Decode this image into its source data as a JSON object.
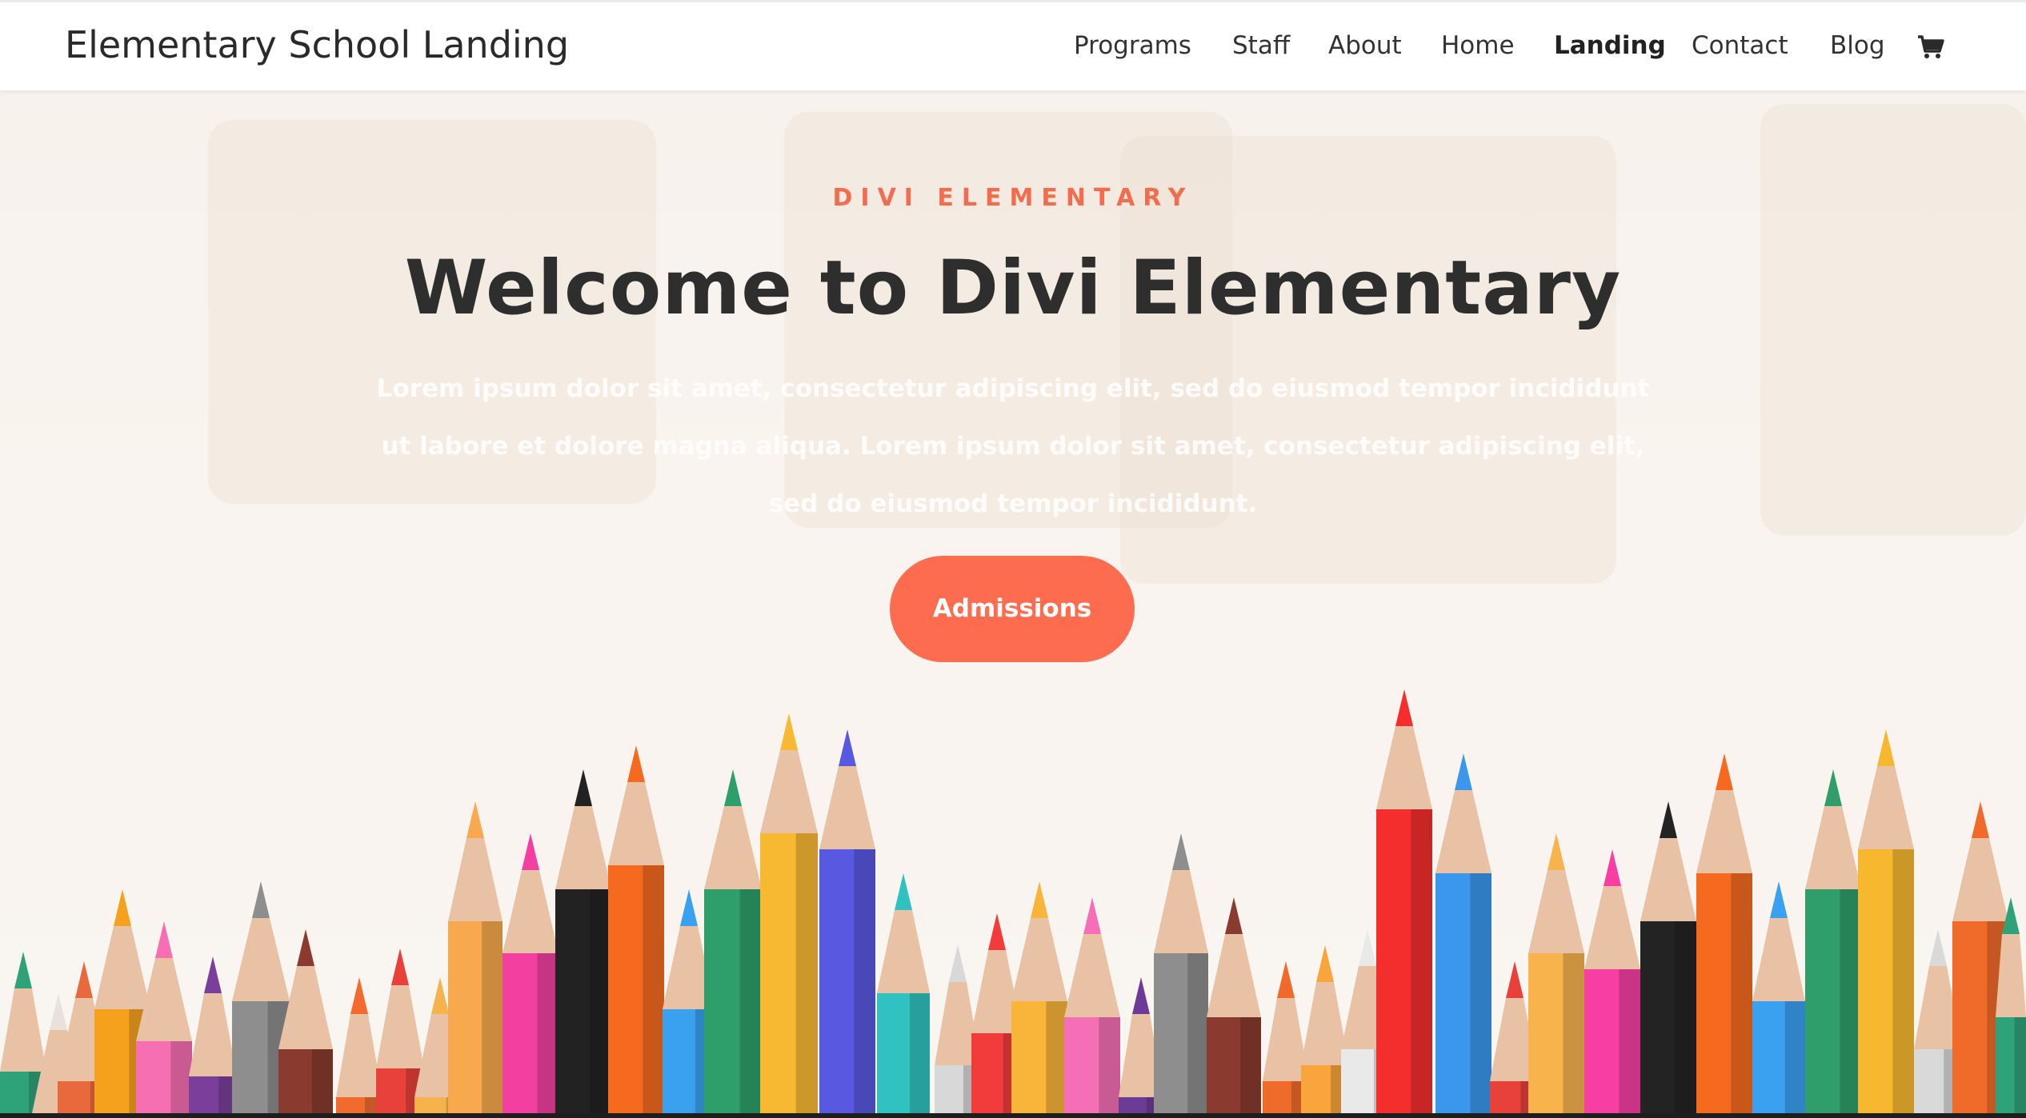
{
  "header": {
    "site_title": "Elementary School Landing",
    "nav": [
      {
        "label": "Programs",
        "active": false
      },
      {
        "label": "Staff",
        "active": false
      },
      {
        "label": "About",
        "active": false
      },
      {
        "label": "Home",
        "active": false
      },
      {
        "label": "Landing",
        "active": true
      },
      {
        "label": "Contact",
        "active": false
      },
      {
        "label": "Blog",
        "active": false
      }
    ],
    "cart_icon": "shopping-cart-icon"
  },
  "hero": {
    "eyebrow": "DIVI ELEMENTARY",
    "title": "Welcome to Divi Elementary",
    "intro": "Lorem ipsum dolor sit amet, consectetur adipiscing elit, sed do eiusmod tempor incididunt ut labore et dolore magna aliqua. Lorem ipsum dolor sit amet, consectetur adipiscing elit, sed do eiusmod tempor incididunt.",
    "cta_label": "Admissions",
    "background_image": "colored pencils"
  },
  "colors": {
    "accent": "#f26d4e",
    "button": "#fd6c4f",
    "heading": "#2e2e2e",
    "header_bg": "#ffffff",
    "hero_bg": "#f8f2ed"
  }
}
